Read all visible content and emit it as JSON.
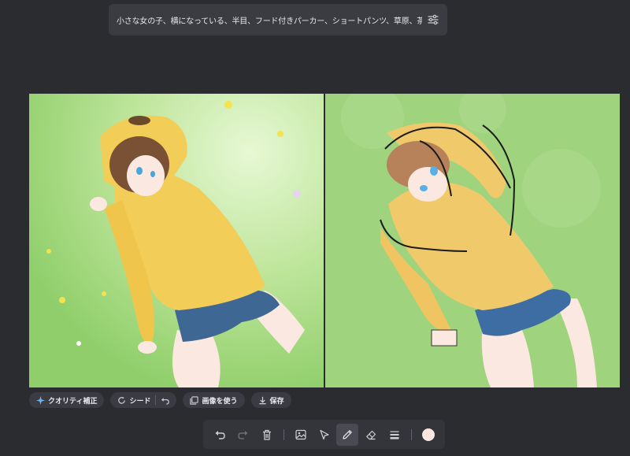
{
  "prompt": {
    "text": "小さな女の子、横になっている、半目、フード付きパーカー、ショートパンツ、草原、茶色のショートカット"
  },
  "actions": {
    "quality_label": "クオリティ補正",
    "seed_label": "シード",
    "use_image_label": "画像を使う",
    "save_label": "保存"
  },
  "toolbar": {
    "tools": [
      "undo-icon",
      "redo-icon",
      "trash-icon",
      "image-icon",
      "cursor-icon",
      "pencil-icon",
      "eraser-icon",
      "stroke-width-icon"
    ],
    "active_tool": "pencil-icon",
    "brush_color": "#fbe6e0"
  },
  "colors": {
    "background": "#2b2c30",
    "panel": "#3b3c42",
    "grass": "#9fd37d",
    "hoodie": "#f1c94e"
  }
}
